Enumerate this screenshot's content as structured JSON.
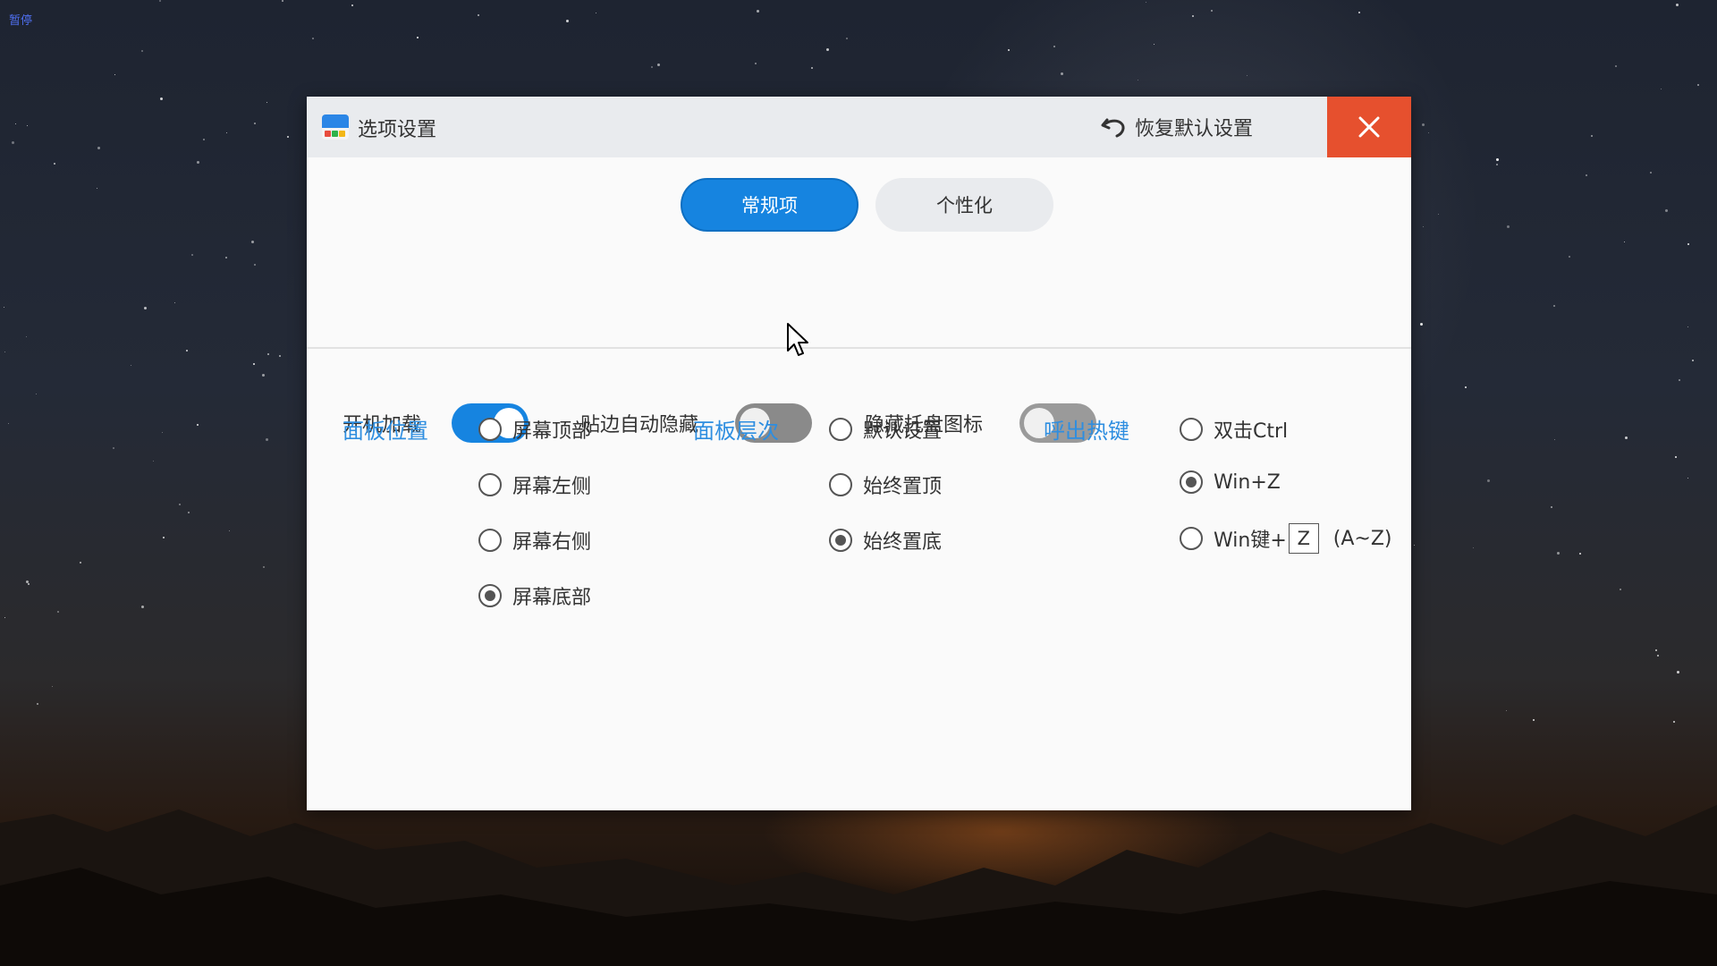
{
  "corner_label": "暂停",
  "window": {
    "title": "选项设置",
    "restore_label": "恢复默认设置"
  },
  "tabs": [
    {
      "label": "常规项",
      "active": true
    },
    {
      "label": "个性化",
      "active": false
    }
  ],
  "toggles": [
    {
      "label": "开机加载",
      "on": true
    },
    {
      "label": "贴边自动隐藏",
      "on": false
    },
    {
      "label": "隐藏托盘图标",
      "on": false
    }
  ],
  "panel_position": {
    "label": "面板位置",
    "options": [
      {
        "label": "屏幕顶部",
        "selected": false
      },
      {
        "label": "屏幕左侧",
        "selected": false
      },
      {
        "label": "屏幕右侧",
        "selected": false
      },
      {
        "label": "屏幕底部",
        "selected": true
      }
    ]
  },
  "panel_layer": {
    "label": "面板层次",
    "options": [
      {
        "label": "默认设置",
        "selected": false
      },
      {
        "label": "始终置顶",
        "selected": false
      },
      {
        "label": "始终置底",
        "selected": true
      }
    ]
  },
  "hotkey": {
    "label": "呼出热键",
    "options": [
      {
        "label": "双击Ctrl",
        "selected": false
      },
      {
        "label": "Win+Z",
        "selected": true
      },
      {
        "label": "Win键+",
        "selected": false
      }
    ],
    "key_value": "Z",
    "key_range": "(A~Z)"
  },
  "colors": {
    "accent": "#1684e0",
    "section_label": "#2e8ee0",
    "close_button": "#e6502e",
    "titlebar": "#e9ebee"
  }
}
